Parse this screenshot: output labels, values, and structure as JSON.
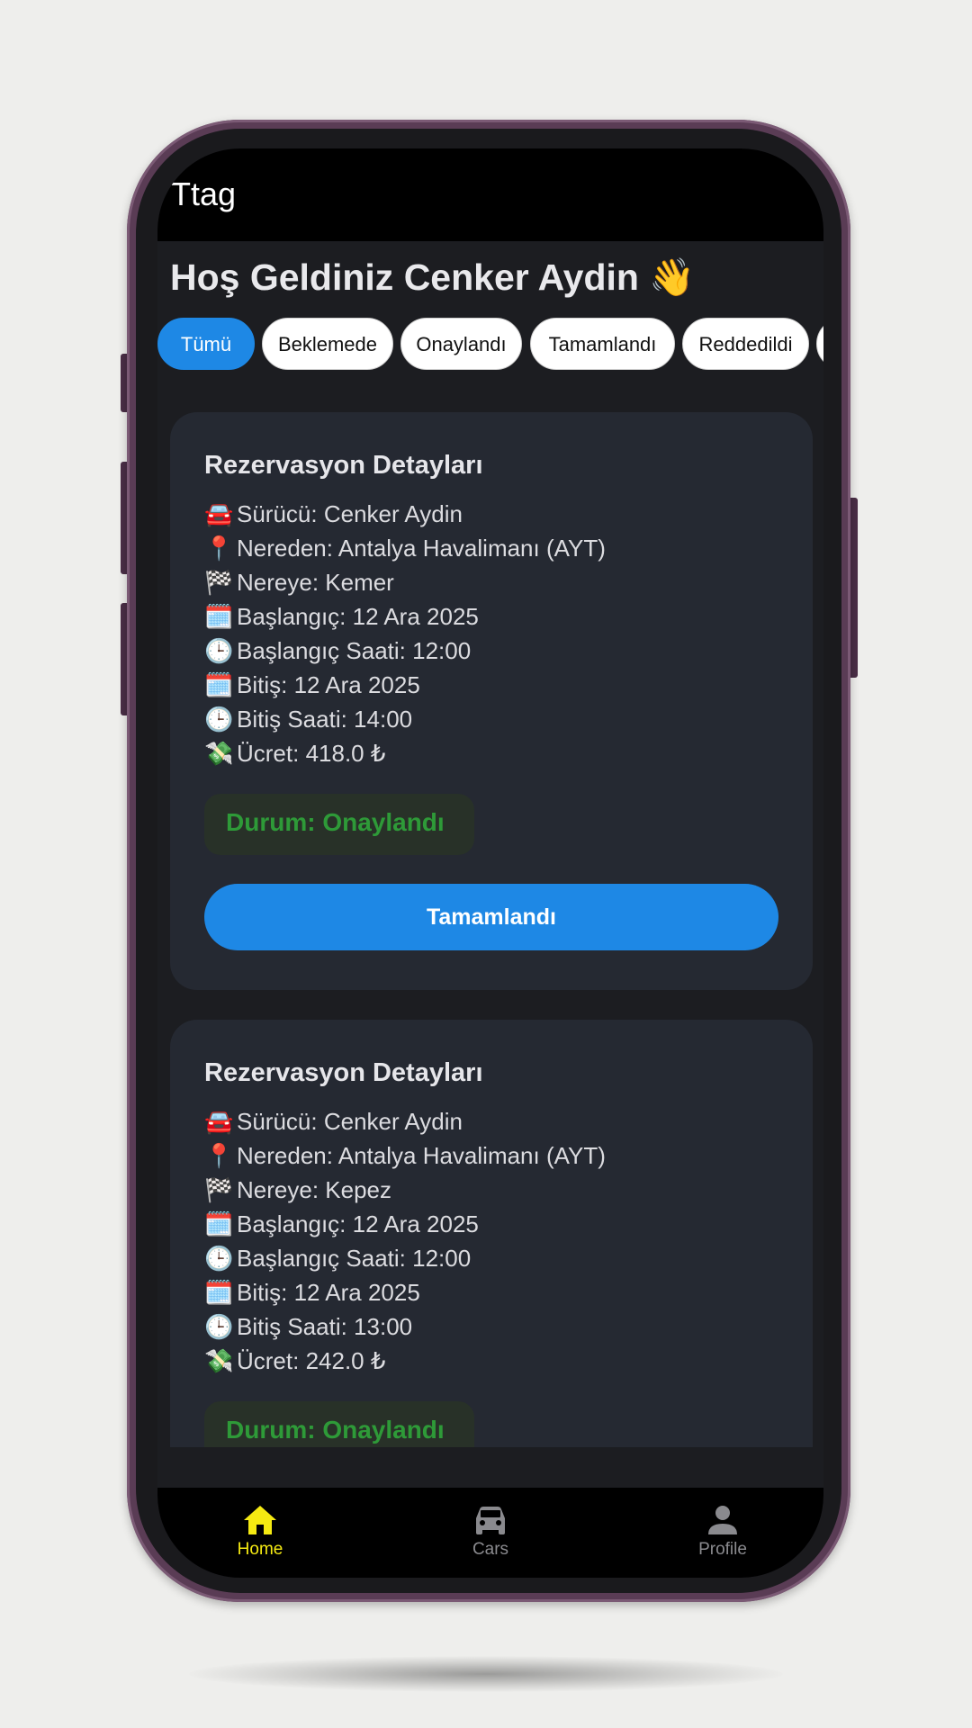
{
  "app": {
    "title": "Ttag"
  },
  "welcome": "Hoş Geldiniz Cenker Aydin 👋",
  "filters": [
    "Tümü",
    "Beklemede",
    "Onaylandı",
    "Tamamlandı",
    "Reddedildi"
  ],
  "active_filter": "Tümü",
  "cards": [
    {
      "title": "Rezervasyon Detayları",
      "lines": [
        {
          "icon": "car-icon",
          "glyph": "🚘",
          "text": "Sürücü: Cenker Aydin"
        },
        {
          "icon": "pin-icon",
          "glyph": "📍",
          "text": "Nereden: Antalya Havalimanı (AYT)"
        },
        {
          "icon": "flag-icon",
          "glyph": "🏁",
          "text": "Nereye: Kemer"
        },
        {
          "icon": "calendar-icon",
          "glyph": "🗓️",
          "text": "Başlangıç: 12 Ara 2025"
        },
        {
          "icon": "clock-icon",
          "glyph": "🕒",
          "text": "Başlangıç Saati: 12:00"
        },
        {
          "icon": "calendar-icon",
          "glyph": "🗓️",
          "text": "Bitiş: 12 Ara 2025"
        },
        {
          "icon": "clock-icon",
          "glyph": "🕒",
          "text": "Bitiş Saati: 14:00"
        },
        {
          "icon": "money-icon",
          "glyph": "💸",
          "text": "Ücret: 418.0 ₺"
        }
      ],
      "status": "Durum: Onaylandı",
      "action": "Tamamlandı"
    },
    {
      "title": "Rezervasyon Detayları",
      "lines": [
        {
          "icon": "car-icon",
          "glyph": "🚘",
          "text": "Sürücü: Cenker Aydin"
        },
        {
          "icon": "pin-icon",
          "glyph": "📍",
          "text": "Nereden: Antalya Havalimanı (AYT)"
        },
        {
          "icon": "flag-icon",
          "glyph": "🏁",
          "text": "Nereye: Kepez"
        },
        {
          "icon": "calendar-icon",
          "glyph": "🗓️",
          "text": "Başlangıç: 12 Ara 2025"
        },
        {
          "icon": "clock-icon",
          "glyph": "🕒",
          "text": "Başlangıç Saati: 12:00"
        },
        {
          "icon": "calendar-icon",
          "glyph": "🗓️",
          "text": "Bitiş: 12 Ara 2025"
        },
        {
          "icon": "clock-icon",
          "glyph": "🕒",
          "text": "Bitiş Saati: 13:00"
        },
        {
          "icon": "money-icon",
          "glyph": "💸",
          "text": "Ücret: 242.0 ₺"
        }
      ],
      "status": "Durum: Onaylandı"
    }
  ],
  "nav": [
    {
      "label": "Home",
      "icon": "home-icon",
      "active": true
    },
    {
      "label": "Cars",
      "icon": "car-icon",
      "active": false
    },
    {
      "label": "Profile",
      "icon": "profile-icon",
      "active": false
    }
  ],
  "colors": {
    "accent": "#1e88e5",
    "nav_active": "#f5ea12",
    "status": "#2e9a38"
  }
}
